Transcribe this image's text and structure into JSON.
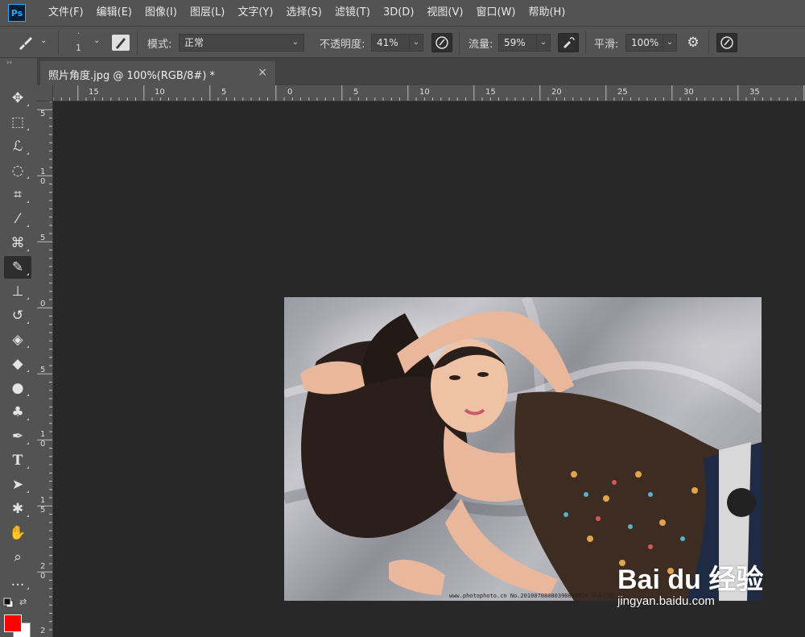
{
  "app": {
    "logo": "Ps"
  },
  "menu": [
    "文件(F)",
    "编辑(E)",
    "图像(I)",
    "图层(L)",
    "文字(Y)",
    "选择(S)",
    "滤镜(T)",
    "3D(D)",
    "视图(V)",
    "窗口(W)",
    "帮助(H)"
  ],
  "options": {
    "brush_size": "1",
    "mode_label": "模式:",
    "mode_value": "正常",
    "opacity_label": "不透明度:",
    "opacity_value": "41%",
    "flow_label": "流量:",
    "flow_value": "59%",
    "smoothing_label": "平滑:",
    "smoothing_value": "100%"
  },
  "tools": [
    {
      "name": "move-tool-icon",
      "glyph": "✥"
    },
    {
      "name": "marquee-tool-icon",
      "glyph": "⬚"
    },
    {
      "name": "lasso-tool-icon",
      "glyph": "ℒ"
    },
    {
      "name": "quick-select-tool-icon",
      "glyph": "◌"
    },
    {
      "name": "crop-tool-icon",
      "glyph": "⌗"
    },
    {
      "name": "eyedropper-tool-icon",
      "glyph": "⁄"
    },
    {
      "name": "healing-brush-tool-icon",
      "glyph": "⌘"
    },
    {
      "name": "brush-tool-icon",
      "glyph": "✎"
    },
    {
      "name": "clone-stamp-tool-icon",
      "glyph": "⊥"
    },
    {
      "name": "history-brush-tool-icon",
      "glyph": "↺"
    },
    {
      "name": "eraser-tool-icon",
      "glyph": "◈"
    },
    {
      "name": "paint-bucket-tool-icon",
      "glyph": "◆"
    },
    {
      "name": "blur-tool-icon",
      "glyph": "●"
    },
    {
      "name": "dodge-tool-icon",
      "glyph": "♣"
    },
    {
      "name": "pen-tool-icon",
      "glyph": "✒"
    },
    {
      "name": "type-tool-icon",
      "glyph": "T"
    },
    {
      "name": "path-select-tool-icon",
      "glyph": "➤"
    },
    {
      "name": "shape-tool-icon",
      "glyph": "✱"
    },
    {
      "name": "hand-tool-icon",
      "glyph": "✋"
    },
    {
      "name": "zoom-tool-icon",
      "glyph": "⌕"
    },
    {
      "name": "more-tools-icon",
      "glyph": "…"
    }
  ],
  "active_tool_index": 7,
  "document": {
    "tab_title": "照片角度.jpg @ 100%(RGB/8#) *",
    "close": "×"
  },
  "ruler_top": [
    "15",
    "10",
    "5",
    "0",
    "5",
    "10",
    "15",
    "20",
    "25",
    "30",
    "35"
  ],
  "ruler_left": [
    "5",
    "1",
    "0",
    "5",
    "0",
    "5",
    "1",
    "0",
    "1",
    "5",
    "2",
    "0",
    "2"
  ],
  "photo": {
    "credit": "www.photophoto.cn  No.20100708080390088824  不天行图"
  },
  "watermark": {
    "brand": "Bai du 经验",
    "sub": "jingyan.baidu.com"
  },
  "colors": {
    "foreground": "#ff0000",
    "background": "#ffffff",
    "accent": "#31a8ff"
  }
}
